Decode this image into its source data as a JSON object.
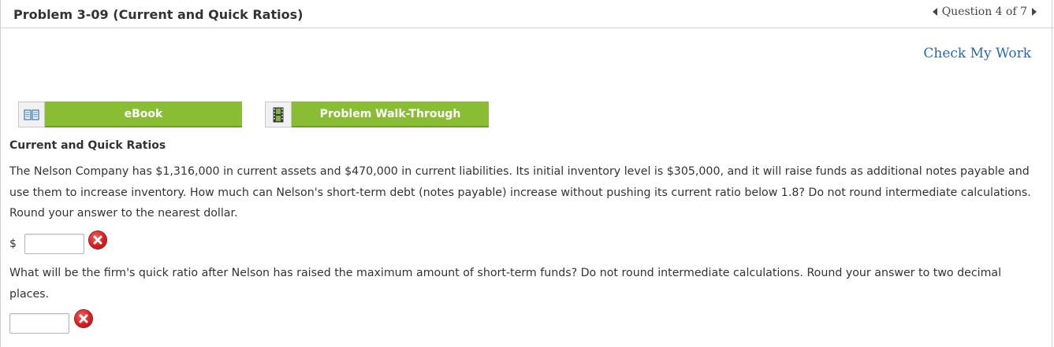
{
  "header": {
    "title": "Problem 3-09 (Current and Quick Ratios)",
    "question_nav": "Question 4 of 7"
  },
  "check_my_work": "Check My Work",
  "tools": {
    "ebook_label": "eBook",
    "walkthrough_label": "Problem Walk-Through",
    "accent_color": "#89be34"
  },
  "content": {
    "section_title": "Current and Quick Ratios",
    "q1_text": "The Nelson Company has $1,316,000 in current assets and $470,000 in current liabilities. Its initial inventory level is $305,000, and it will raise funds as additional notes payable and use them to increase inventory. How much can Nelson's short-term debt (notes payable) increase without pushing its current ratio below 1.8? Do not round intermediate calculations. Round your answer to the nearest dollar.",
    "q1_prefix": "$",
    "q1_value": "",
    "q2_text": "What will be the firm's quick ratio after Nelson has raised the maximum amount of short-term funds? Do not round intermediate calculations. Round your answer to two decimal places.",
    "q2_value": ""
  },
  "icons": {
    "prev": "triangle-left-icon",
    "next": "triangle-right-icon",
    "ebook": "book-icon",
    "walkthrough": "film-icon",
    "incorrect": "incorrect-x-icon"
  }
}
